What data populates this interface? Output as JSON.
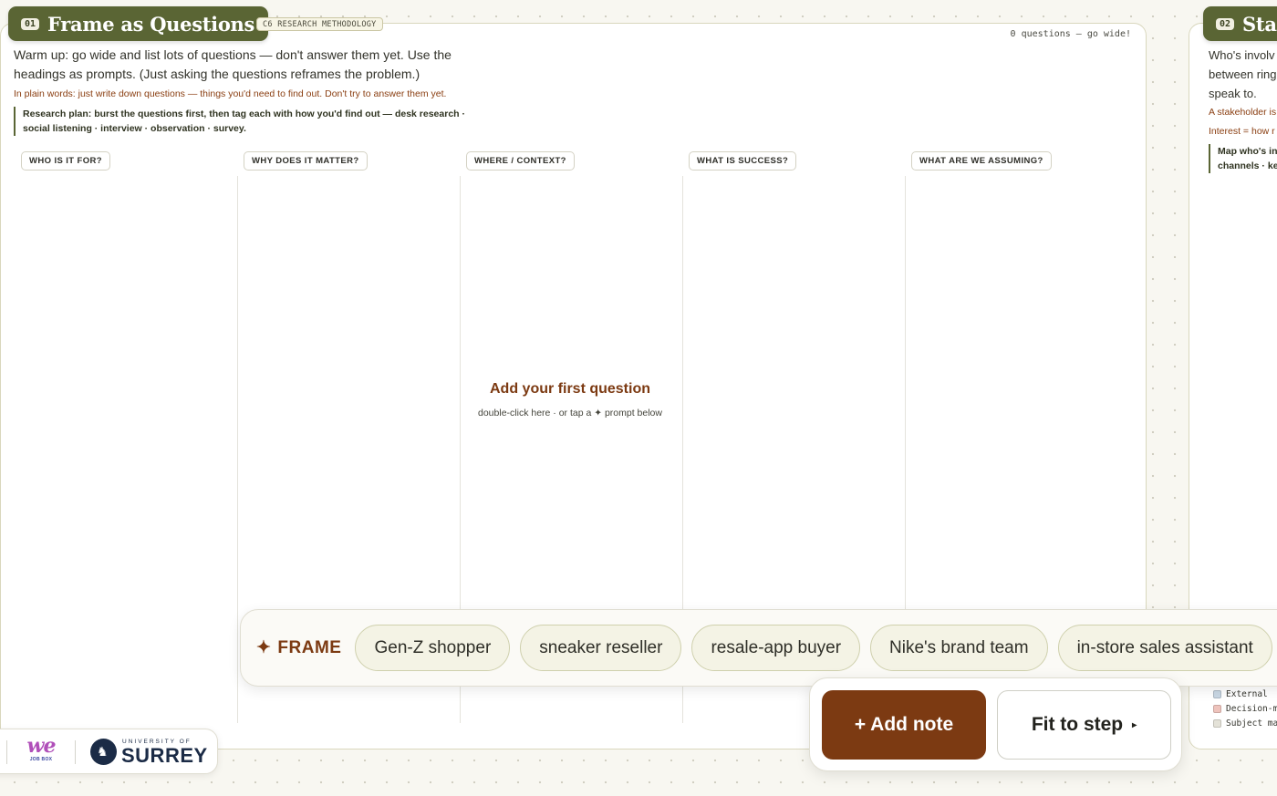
{
  "step1": {
    "number": "01",
    "title": "Frame as Questions",
    "method_tag": "C6 RESEARCH METHODOLOGY",
    "question_count": "0 questions — go wide!",
    "intro": "Warm up: go wide and list lots of questions — don't answer them yet. Use the headings as prompts. (Just asking the questions reframes the problem.)",
    "plain_words": "In plain words: just write down questions — things you'd need to find out. Don't try to answer them yet.",
    "research_plan": "Research plan: burst the questions first, then tag each with how you'd find out — desk research · social listening · interview · observation · survey.",
    "columns": [
      "WHO IS IT FOR?",
      "WHY DOES IT MATTER?",
      "WHERE / CONTEXT?",
      "WHAT IS SUCCESS?",
      "WHAT ARE WE ASSUMING?"
    ],
    "empty_state": {
      "title": "Add your first question",
      "subtitle": "double-click here · or tap a ✦ prompt below"
    }
  },
  "step2": {
    "number": "02",
    "title": "Stal",
    "lines": [
      "Who's involv",
      "between ring",
      "speak to."
    ],
    "red_lines": [
      "A stakeholder is",
      "Interest = how r"
    ],
    "plan_lines": [
      "Map who's in",
      "channels · ke"
    ],
    "legend": [
      {
        "label": "External",
        "color": "#c9d7e4"
      },
      {
        "label": "Decision-ma",
        "color": "#eec3bc"
      },
      {
        "label": "Subject mat",
        "color": "#e4e2d8"
      }
    ]
  },
  "prompt_bar": {
    "icon": "✦",
    "label": "FRAME",
    "chips": [
      "Gen-Z shopper",
      "sneaker reseller",
      "resale-app buyer",
      "Nike's brand team",
      "in-store sales assistant"
    ]
  },
  "actions": {
    "add_note": "+ Add note",
    "fit_to_step": "Fit to step",
    "fit_icon": "▸"
  },
  "logos": {
    "we_text": "we",
    "we_sub": "JOB BOX",
    "university_of": "UNIVERSITY OF",
    "surrey": "SURREY"
  },
  "colors": {
    "olive": "#5a6534",
    "rust": "#7c3a12",
    "chip_bg": "#f4f3e5",
    "canvas": "#f8f7f1"
  }
}
